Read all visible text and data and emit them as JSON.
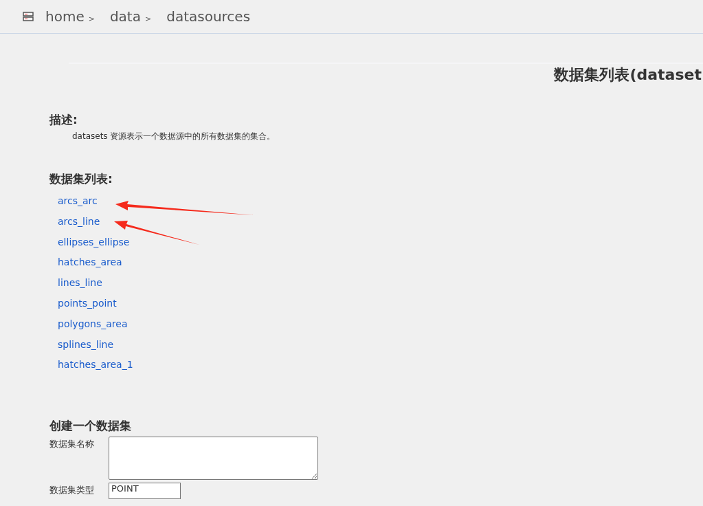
{
  "breadcrumb": [
    {
      "label": "home",
      "separator": ">"
    },
    {
      "label": "data",
      "separator": ">"
    },
    {
      "label": "datasources"
    }
  ],
  "page_title": "数据集列表(dataset",
  "description": {
    "heading": "描述:",
    "text": "datasets 资源表示一个数据源中的所有数据集的集合。"
  },
  "datasets": {
    "heading": "数据集列表:",
    "items": [
      "arcs_arc",
      "arcs_line",
      "ellipses_ellipse",
      "hatches_area",
      "lines_line",
      "points_point",
      "polygons_area",
      "splines_line",
      "hatches_area_1"
    ]
  },
  "create_form": {
    "heading": "创建一个数据集",
    "fields": [
      {
        "label": "数据集名称",
        "kind": "textarea"
      },
      {
        "label": "数据集类型",
        "kind": "select",
        "value": "POINT"
      }
    ]
  }
}
